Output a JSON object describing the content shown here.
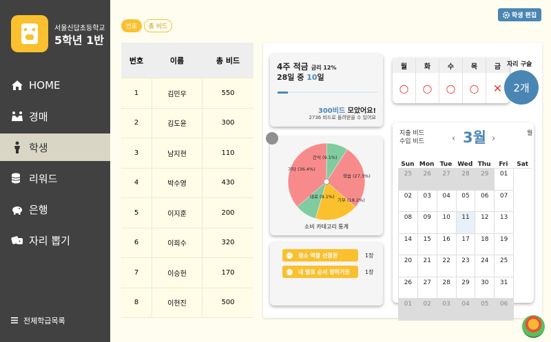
{
  "sidebar": {
    "school": "서울신답초등학교",
    "class_name": "5학년 1반",
    "nav": [
      {
        "label": "HOME",
        "icon": "home-icon"
      },
      {
        "label": "경매",
        "icon": "handshake-icon"
      },
      {
        "label": "학생",
        "icon": "person-icon"
      },
      {
        "label": "리워드",
        "icon": "coins-icon"
      },
      {
        "label": "은행",
        "icon": "piggy-bank-icon"
      },
      {
        "label": "자리 뽑기",
        "icon": "dice-icon"
      }
    ],
    "footer": "전체학급목록"
  },
  "header": {
    "tabs": [
      "번호",
      "총 비드"
    ],
    "edit_label": "학생 편집"
  },
  "table": {
    "headers": [
      "번호",
      "이름",
      "총 비드"
    ],
    "rows": [
      [
        "1",
        "김민우",
        "550"
      ],
      [
        "2",
        "김도윤",
        "300"
      ],
      [
        "3",
        "남지현",
        "110"
      ],
      [
        "4",
        "박수영",
        "430"
      ],
      [
        "5",
        "이지훈",
        "200"
      ],
      [
        "6",
        "이희수",
        "320"
      ],
      [
        "7",
        "이승헌",
        "170"
      ],
      [
        "8",
        "이현진",
        "500"
      ]
    ]
  },
  "savings": {
    "title": "4주 적금",
    "rate": "금리 12%",
    "day_prefix": "28일 중 ",
    "day_value": "10",
    "day_suffix": "일",
    "progress": 0.1,
    "goal_amount": "300비드",
    "goal_suffix": " 모았어요!",
    "remaining": "2736 비드로 돌려받을 수 있어요"
  },
  "week": {
    "days": [
      "월",
      "화",
      "수",
      "목",
      "금"
    ],
    "marks": [
      "○",
      "○",
      "○",
      "○",
      "✕"
    ]
  },
  "seat": {
    "label": "자리 구슬",
    "value": "2개"
  },
  "pie": {
    "caption": "소비 카테고리 통계",
    "slices": [
      {
        "name": "간식",
        "pct": 9.1,
        "color": "#80cba0"
      },
      {
        "name": "학습",
        "pct": 27.3,
        "color": "#f78b8b"
      },
      {
        "name": "기부",
        "pct": 18.2,
        "color": "#fbc02d"
      },
      {
        "name": "대로",
        "pct": 9.1,
        "color": "#80cba0"
      },
      {
        "name": "기타",
        "pct": 36.4,
        "color": "#f78b8b"
      }
    ],
    "labels": [
      "간식 (9.1%)",
      "학습 (27.3%)",
      "기부 (18.2%)",
      "대로 (9.1%)",
      "기타 (36.4%)"
    ]
  },
  "coupons": {
    "items": [
      {
        "label": "청소 역할 선점권",
        "count": "1장"
      },
      {
        "label": "내 발표 순서 정하기권",
        "count": "1장"
      }
    ]
  },
  "calendar": {
    "spend_label": "지출 비드",
    "income_label": "수입 비드",
    "month": "3월",
    "unit": "월",
    "weekdays": [
      "Sun",
      "Mon",
      "Tue",
      "Wed",
      "Thu",
      "Fri",
      "Sat"
    ],
    "cells": [
      "25",
      "26",
      "27",
      "28",
      "29",
      "01",
      "02",
      "03",
      "04",
      "05",
      "06",
      "07",
      "08",
      "09",
      "10",
      "11",
      "12",
      "13",
      "14",
      "15",
      "16",
      "17",
      "18",
      "19",
      "20",
      "21",
      "22",
      "23",
      "24",
      "25",
      "26",
      "27",
      "28",
      "29",
      "30",
      "31",
      "01",
      "02",
      "03",
      "04",
      "05",
      "06"
    ],
    "prev": "‹",
    "next": "›"
  }
}
